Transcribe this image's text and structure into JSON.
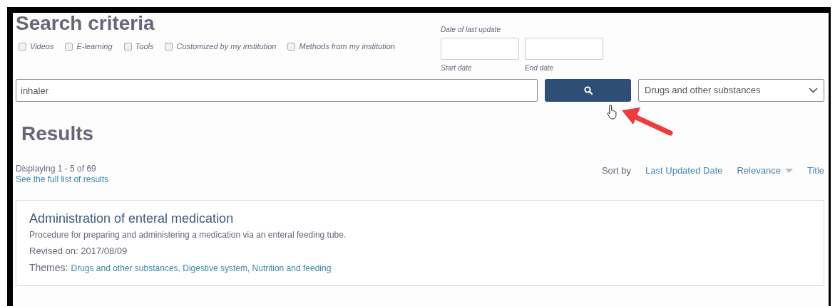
{
  "search_criteria": {
    "title": "Search criteria",
    "filters": [
      {
        "label": "Videos",
        "checked": false
      },
      {
        "label": "E-learning",
        "checked": false
      },
      {
        "label": "Tools",
        "checked": false
      },
      {
        "label": "Customized by my institution",
        "checked": false
      },
      {
        "label": "Methods from my institution",
        "checked": false
      }
    ],
    "date_range": {
      "label": "Date of last update",
      "start_label": "Start date",
      "end_label": "End date"
    },
    "query": "inhaler",
    "category": "Drugs and other substances"
  },
  "results": {
    "title": "Results",
    "count": "Displaying 1 - 5 of 69",
    "full_list_link": "See the full list of results",
    "sort_label": "Sort by",
    "sort_options": [
      {
        "label": "Last Updated Date",
        "selected": false
      },
      {
        "label": "Relevance",
        "selected": true
      },
      {
        "label": "Title",
        "selected": false
      }
    ],
    "items": [
      {
        "title": "Administration of enteral medication",
        "description": "Procedure for preparing and administering a medication via an enteral feeding tube.",
        "revised": "Revised on: 2017/08/09",
        "themes_label": "Themes:",
        "themes": "Drugs and other substances, Digestive system, Nutrition and feeding"
      }
    ]
  }
}
